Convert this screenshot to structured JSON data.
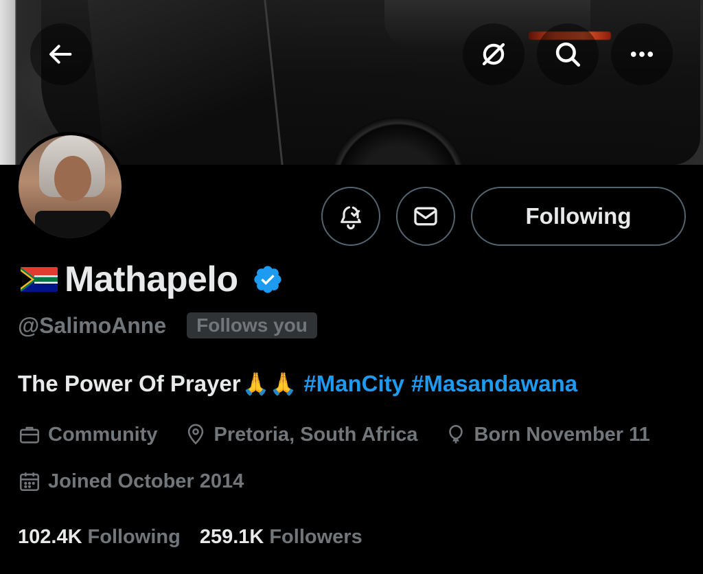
{
  "header": {
    "back_icon": "arrow-left-icon",
    "grok_icon": "grok-icon",
    "search_icon": "search-icon",
    "more_icon": "more-horizontal-icon"
  },
  "banner": {
    "description_icon": "car-photo-banner"
  },
  "actions": {
    "notify_icon": "bell-check-icon",
    "message_icon": "envelope-icon",
    "following_label": "Following"
  },
  "profile": {
    "flag_icon": "south-africa-flag-icon",
    "name": "Mathapelo",
    "verified_icon": "verified-badge-icon",
    "handle": "@SalimoAnne",
    "follows_you": "Follows you"
  },
  "bio": {
    "text": "The Power Of Prayer",
    "emoji": "🙏🙏",
    "hashtags": [
      "#ManCity",
      "#Masandawana"
    ]
  },
  "meta": {
    "category": "Community",
    "location": "Pretoria, South Africa",
    "birthday": "Born November 11",
    "joined": "Joined October 2014"
  },
  "stats": {
    "following_count": "102.4K",
    "following_label": "Following",
    "followers_count": "259.1K",
    "followers_label": "Followers"
  },
  "colors": {
    "background": "#000000",
    "text_primary": "#e7e9ea",
    "text_secondary": "#71767b",
    "accent": "#1d9bf0",
    "border": "#536471"
  }
}
